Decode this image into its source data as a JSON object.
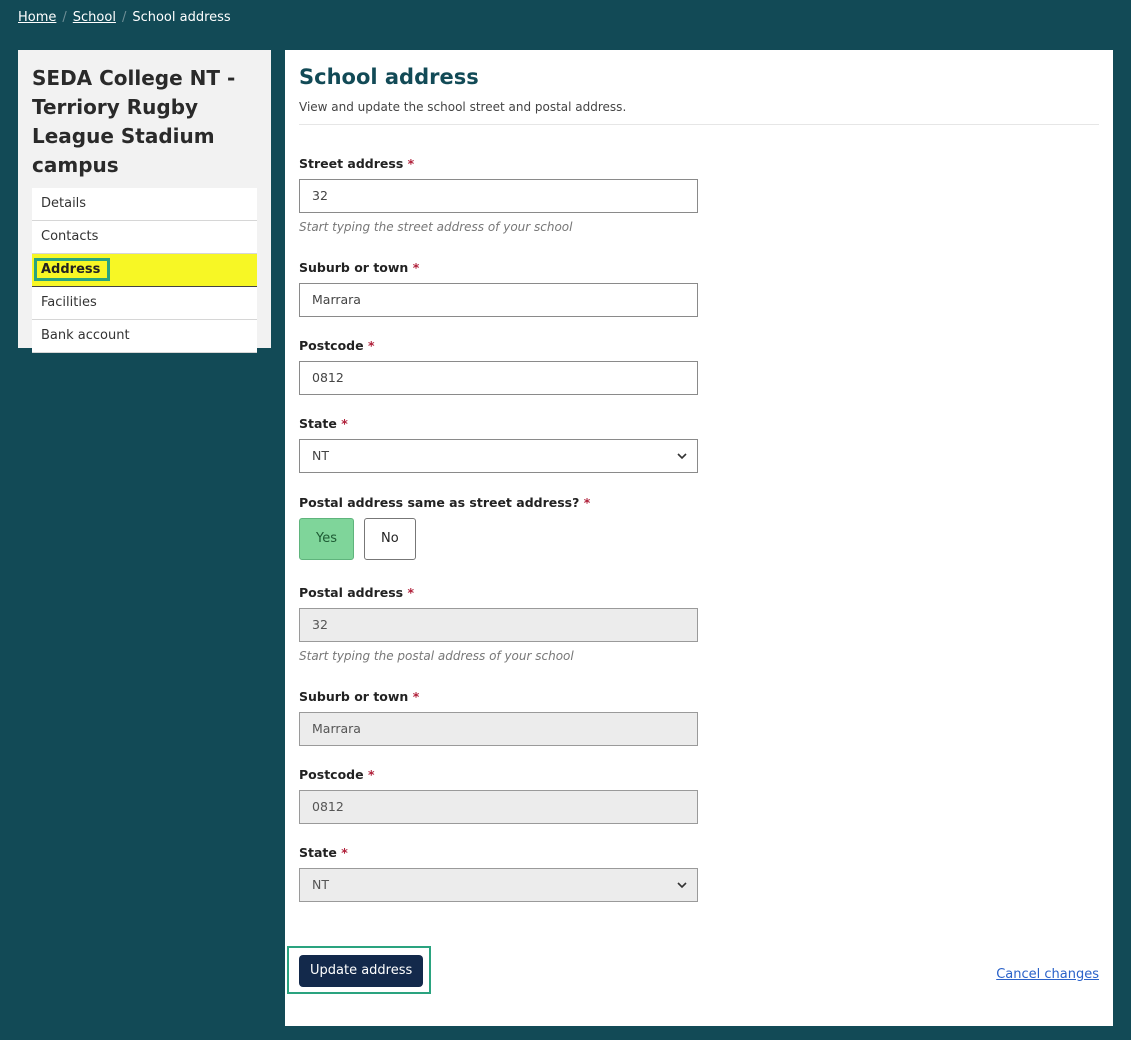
{
  "breadcrumb": {
    "home": "Home",
    "school": "School",
    "current": "School address"
  },
  "sidebar": {
    "title": "SEDA College NT - Terriory Rugby League Stadium campus",
    "items": [
      {
        "label": "Details"
      },
      {
        "label": "Contacts"
      },
      {
        "label": "Address"
      },
      {
        "label": "Facilities"
      },
      {
        "label": "Bank account"
      }
    ],
    "active": "Address"
  },
  "main": {
    "title": "School address",
    "subtitle": "View and update the school street and postal address.",
    "required_mark": "*",
    "street_address": {
      "label": "Street address",
      "value": "32",
      "hint": "Start typing the street address of your school"
    },
    "suburb": {
      "label": "Suburb or town",
      "value": "Marrara"
    },
    "postcode": {
      "label": "Postcode",
      "value": "0812"
    },
    "state": {
      "label": "State",
      "value": "NT"
    },
    "postal_same": {
      "label": "Postal address same as street address?",
      "yes": "Yes",
      "no": "No",
      "selected": "Yes"
    },
    "postal_address": {
      "label": "Postal address",
      "value": "32",
      "hint": "Start typing the postal address of your school"
    },
    "postal_suburb": {
      "label": "Suburb or town",
      "value": "Marrara"
    },
    "postal_postcode": {
      "label": "Postcode",
      "value": "0812"
    },
    "postal_state": {
      "label": "State",
      "value": "NT"
    },
    "update_button": "Update address",
    "cancel_link": "Cancel changes"
  },
  "colors": {
    "background": "#124a56",
    "active_nav": "#f7f725",
    "primary_button": "#13294b",
    "yes_selected": "#7fd59a",
    "highlight_outline": "#2aa37f"
  }
}
